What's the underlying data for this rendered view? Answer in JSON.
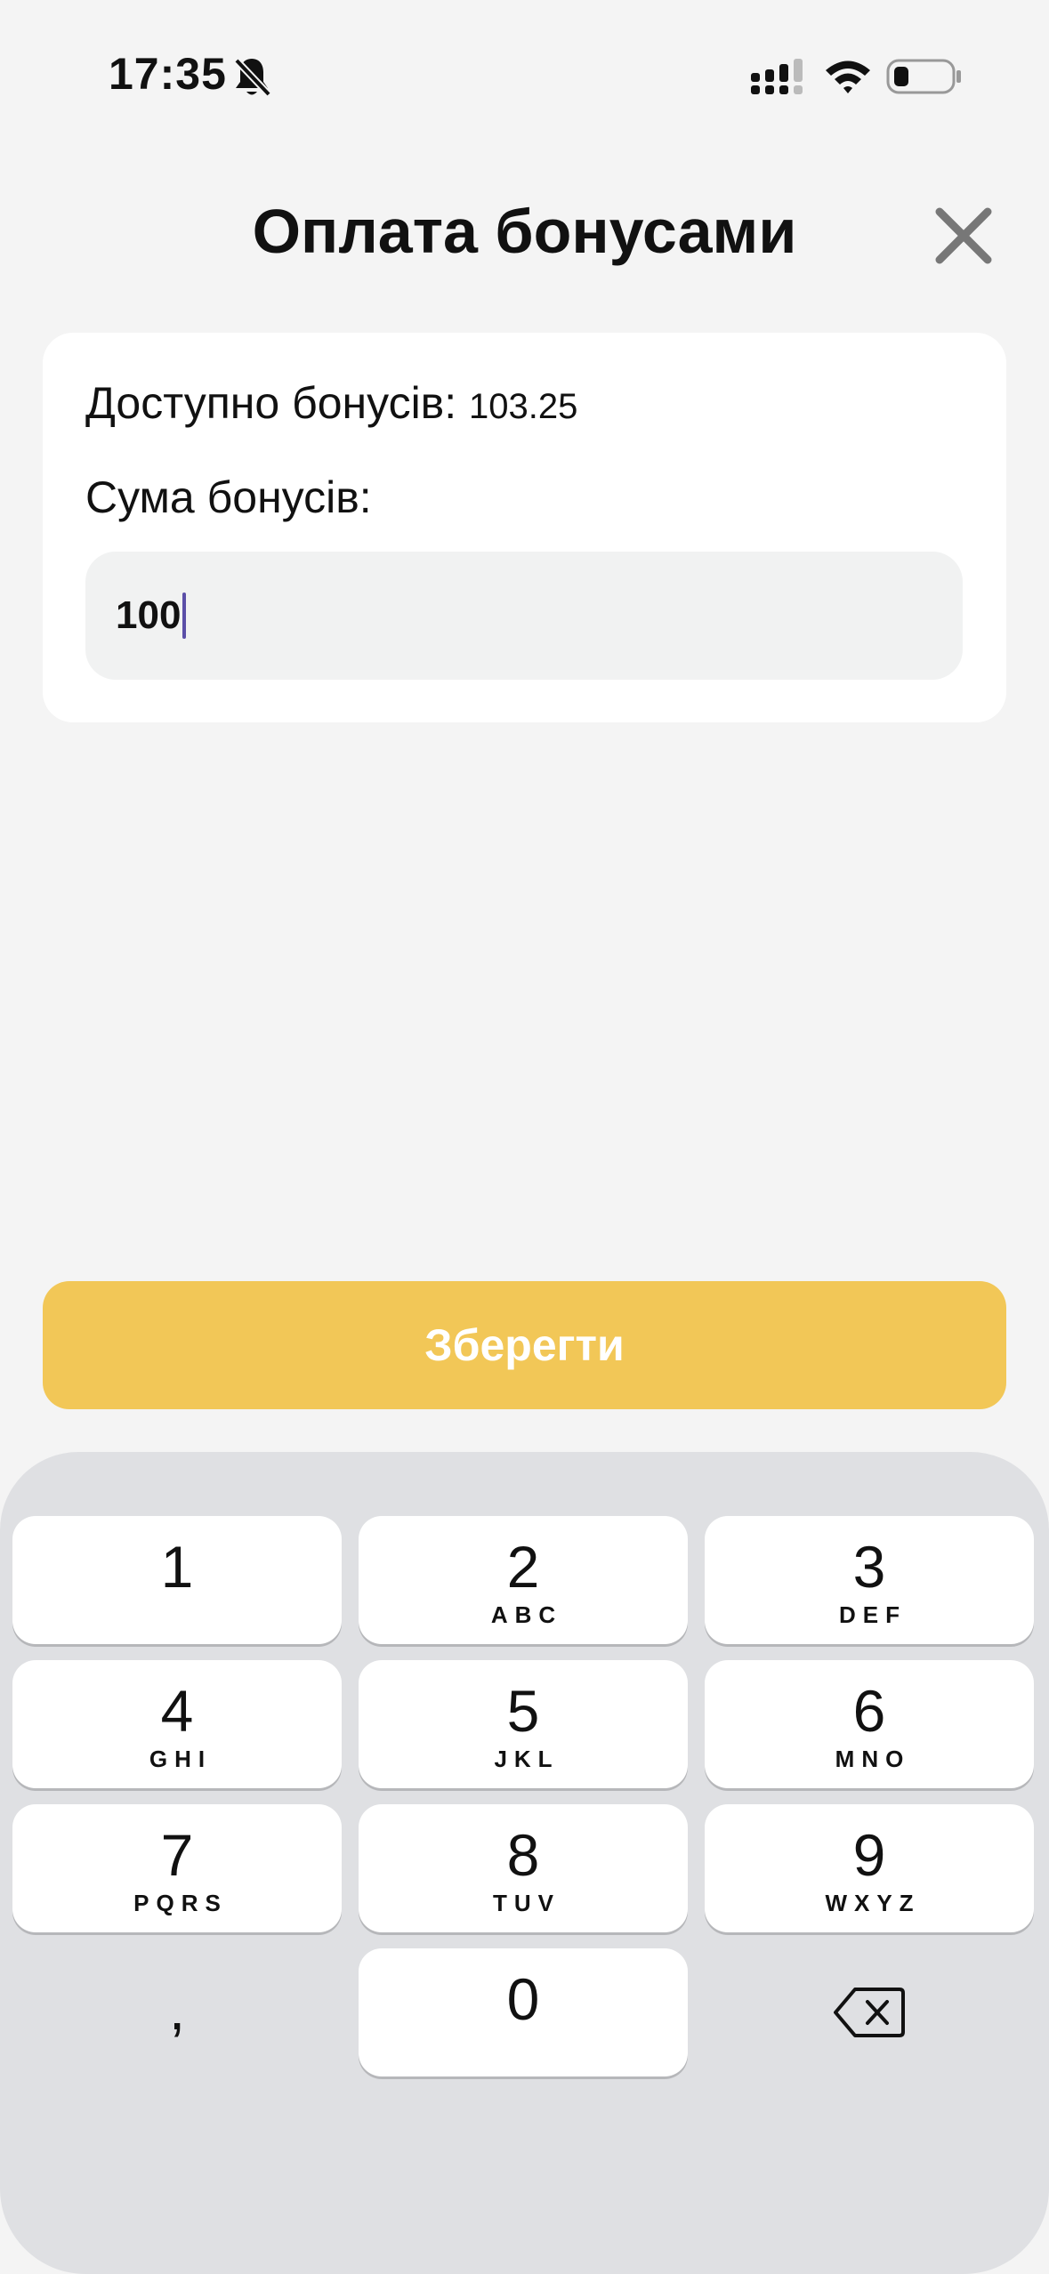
{
  "status_bar": {
    "time": "17:35",
    "icons": [
      "bell-slash-icon",
      "cellular-signal-icon",
      "wifi-icon",
      "battery-icon"
    ]
  },
  "header": {
    "title": "Оплата бонусами",
    "close_icon": "close-icon"
  },
  "card": {
    "available_label": "Доступно бонусів:",
    "available_value": "103.25",
    "sum_label": "Сума бонусів:",
    "amount_value": "100"
  },
  "save_button": {
    "label": "Зберегти"
  },
  "keyboard": {
    "keys": [
      {
        "digit": "1",
        "letters": ""
      },
      {
        "digit": "2",
        "letters": "ABC"
      },
      {
        "digit": "3",
        "letters": "DEF"
      },
      {
        "digit": "4",
        "letters": "GHI"
      },
      {
        "digit": "5",
        "letters": "JKL"
      },
      {
        "digit": "6",
        "letters": "MNO"
      },
      {
        "digit": "7",
        "letters": "PQRS"
      },
      {
        "digit": "8",
        "letters": "TUV"
      },
      {
        "digit": "9",
        "letters": "WXYZ"
      }
    ],
    "zero": "0",
    "comma": ",",
    "backspace_icon": "backspace-icon"
  },
  "colors": {
    "background": "#f4f4f4",
    "accent": "#f2c757",
    "caret": "#5b4fa8",
    "keyboard": "#dfe0e3"
  }
}
